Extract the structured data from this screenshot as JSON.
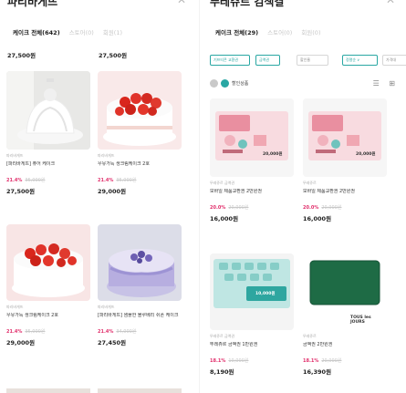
{
  "left": {
    "title": "파리바게뜨",
    "tabs": [
      "케이크 전체(642)",
      "스토어(0)",
      "회원(1)"
    ],
    "top_prices": [
      "27,500원",
      "27,500원"
    ],
    "products": [
      {
        "brand": "파리바게뜨",
        "name": "[파리바게뜨] 퓨어 케이크",
        "discount": "21.4%",
        "original": "35,000원",
        "price": "27,500원"
      },
      {
        "brand": "파리바게뜨",
        "name": "우유가득 생크림케이크 2호",
        "discount": "21.4%",
        "original": "35,000원",
        "price": "29,000원"
      },
      {
        "brand": "파리바게뜨",
        "name": "우유가득 생크림케이크 2호",
        "discount": "21.4%",
        "original": "35,000원",
        "price": "29,000원"
      },
      {
        "brand": "파리바게뜨",
        "name": "[파리바게뜨] 샘플한 블루베리 쉬폰 케이크",
        "discount": "21.4%",
        "original": "34,000원",
        "price": "27,450원"
      }
    ]
  },
  "right": {
    "title": "뚜레쥬르 검색결",
    "tabs": [
      "케이크 전체(29)",
      "스토어(0)",
      "회원(0)"
    ],
    "chips": [
      "기프티콘 교환권",
      "금액권",
      "할인율",
      "정렬순 ∨",
      "가격대"
    ],
    "toggle_label": "할인상품",
    "view_icons": "☰ ⊞",
    "products": [
      {
        "brand": "뚜레쥬르 금액권",
        "name": "모바일 제품교환권 2만원권",
        "discount": "20.0%",
        "original": "20,000원",
        "price": "16,000원",
        "tag": "20,000원"
      },
      {
        "brand": "뚜레쥬르",
        "name": "모바일 제품교환권 2만원권",
        "discount": "20.0%",
        "original": "20,000원",
        "price": "16,000원",
        "tag": "20,000원"
      },
      {
        "brand": "뚜레쥬르 금액권",
        "name": "뚜레쥬르 금액권 1만원권",
        "discount": "18.1%",
        "original": "10,000원",
        "price": "8,190원",
        "tag": "10,000원"
      },
      {
        "brand": "뚜레쥬르",
        "name": "금액권 2만원권",
        "discount": "18.1%",
        "original": "20,000원",
        "price": "16,390원",
        "tag": "TOUS les JOURS"
      }
    ]
  },
  "colors": {
    "accent": "#29a7a3",
    "discount": "#e1306c"
  }
}
